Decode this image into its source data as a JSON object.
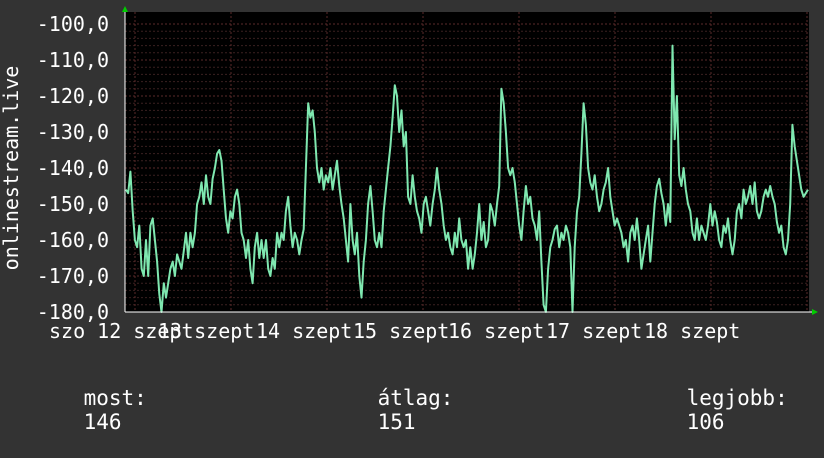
{
  "chart_data": {
    "type": "line",
    "ylabel": "onlinestream.live",
    "ylim": [
      -180,
      -100
    ],
    "yticks": [
      "-100,0",
      "-110,0",
      "-120,0",
      "-130,0",
      "-140,0",
      "-150,0",
      "-160,0",
      "-170,0",
      "-180,0"
    ],
    "xticks": [
      "szo 12 szept",
      "13 szept",
      "14 szept",
      "15 szept",
      "16 szept",
      "17 szept",
      "18 szept"
    ],
    "grid": true,
    "colors": {
      "background": "#333333",
      "plot_background": "#000000",
      "grid_major": "#5a2a2a",
      "grid_minor": "#3a2020",
      "line": "#7fe8b0",
      "axis": "#ffffff",
      "arrow": "#00cc00"
    },
    "series": [
      {
        "values": [
          -146,
          -147,
          -141,
          -152,
          -160,
          -162,
          -156,
          -168,
          -170,
          -160,
          -170,
          -156,
          -154,
          -160,
          -166,
          -175,
          -180,
          -172,
          -176,
          -172,
          -168,
          -166,
          -170,
          -164,
          -166,
          -168,
          -163,
          -158,
          -165,
          -158,
          -162,
          -158,
          -150,
          -148,
          -144,
          -150,
          -142,
          -148,
          -150,
          -143,
          -140,
          -136,
          -135,
          -138,
          -146,
          -154,
          -158,
          -152,
          -154,
          -148,
          -146,
          -150,
          -158,
          -160,
          -165,
          -160,
          -168,
          -172,
          -162,
          -158,
          -165,
          -160,
          -165,
          -160,
          -168,
          -170,
          -165,
          -168,
          -158,
          -162,
          -158,
          -160,
          -152,
          -148,
          -156,
          -162,
          -158,
          -160,
          -164,
          -160,
          -157,
          -140,
          -122,
          -126,
          -124,
          -130,
          -140,
          -144,
          -140,
          -146,
          -142,
          -144,
          -140,
          -146,
          -142,
          -138,
          -145,
          -150,
          -154,
          -160,
          -166,
          -150,
          -160,
          -164,
          -158,
          -170,
          -176,
          -166,
          -160,
          -150,
          -145,
          -152,
          -160,
          -162,
          -158,
          -162,
          -152,
          -146,
          -140,
          -134,
          -126,
          -117,
          -120,
          -130,
          -124,
          -134,
          -130,
          -148,
          -150,
          -142,
          -148,
          -152,
          -154,
          -158,
          -150,
          -148,
          -152,
          -156,
          -150,
          -146,
          -140,
          -146,
          -150,
          -156,
          -160,
          -158,
          -162,
          -164,
          -158,
          -162,
          -154,
          -160,
          -162,
          -160,
          -168,
          -162,
          -168,
          -164,
          -158,
          -150,
          -160,
          -155,
          -162,
          -160,
          -150,
          -152,
          -156,
          -150,
          -145,
          -118,
          -122,
          -130,
          -140,
          -142,
          -140,
          -144,
          -150,
          -156,
          -160,
          -152,
          -145,
          -150,
          -148,
          -154,
          -156,
          -160,
          -152,
          -166,
          -178,
          -182,
          -168,
          -162,
          -160,
          -157,
          -156,
          -162,
          -158,
          -160,
          -156,
          -158,
          -162,
          -180,
          -162,
          -152,
          -148,
          -136,
          -122,
          -128,
          -140,
          -144,
          -146,
          -142,
          -148,
          -152,
          -150,
          -146,
          -144,
          -140,
          -148,
          -152,
          -156,
          -154,
          -156,
          -158,
          -162,
          -160,
          -166,
          -158,
          -156,
          -160,
          -154,
          -160,
          -168,
          -164,
          -160,
          -156,
          -166,
          -158,
          -150,
          -145,
          -143,
          -147,
          -150,
          -156,
          -150,
          -155,
          -106,
          -132,
          -120,
          -142,
          -145,
          -140,
          -146,
          -150,
          -152,
          -158,
          -160,
          -154,
          -160,
          -156,
          -158,
          -160,
          -156,
          -150,
          -156,
          -152,
          -155,
          -160,
          -162,
          -156,
          -158,
          -154,
          -160,
          -164,
          -160,
          -152,
          -150,
          -154,
          -146,
          -150,
          -148,
          -145,
          -150,
          -144,
          -152,
          -154,
          -152,
          -148,
          -146,
          -148,
          -145,
          -148,
          -150,
          -155,
          -158,
          -156,
          -162,
          -164,
          -160,
          -150,
          -128,
          -134,
          -138,
          -142,
          -146,
          -148,
          -147,
          -146
        ]
      }
    ]
  },
  "stats": {
    "current": {
      "label": "most:",
      "value": "146"
    },
    "average": {
      "label": "átlag:",
      "value": "151"
    },
    "best": {
      "label": "legjobb:",
      "value": "106"
    }
  }
}
